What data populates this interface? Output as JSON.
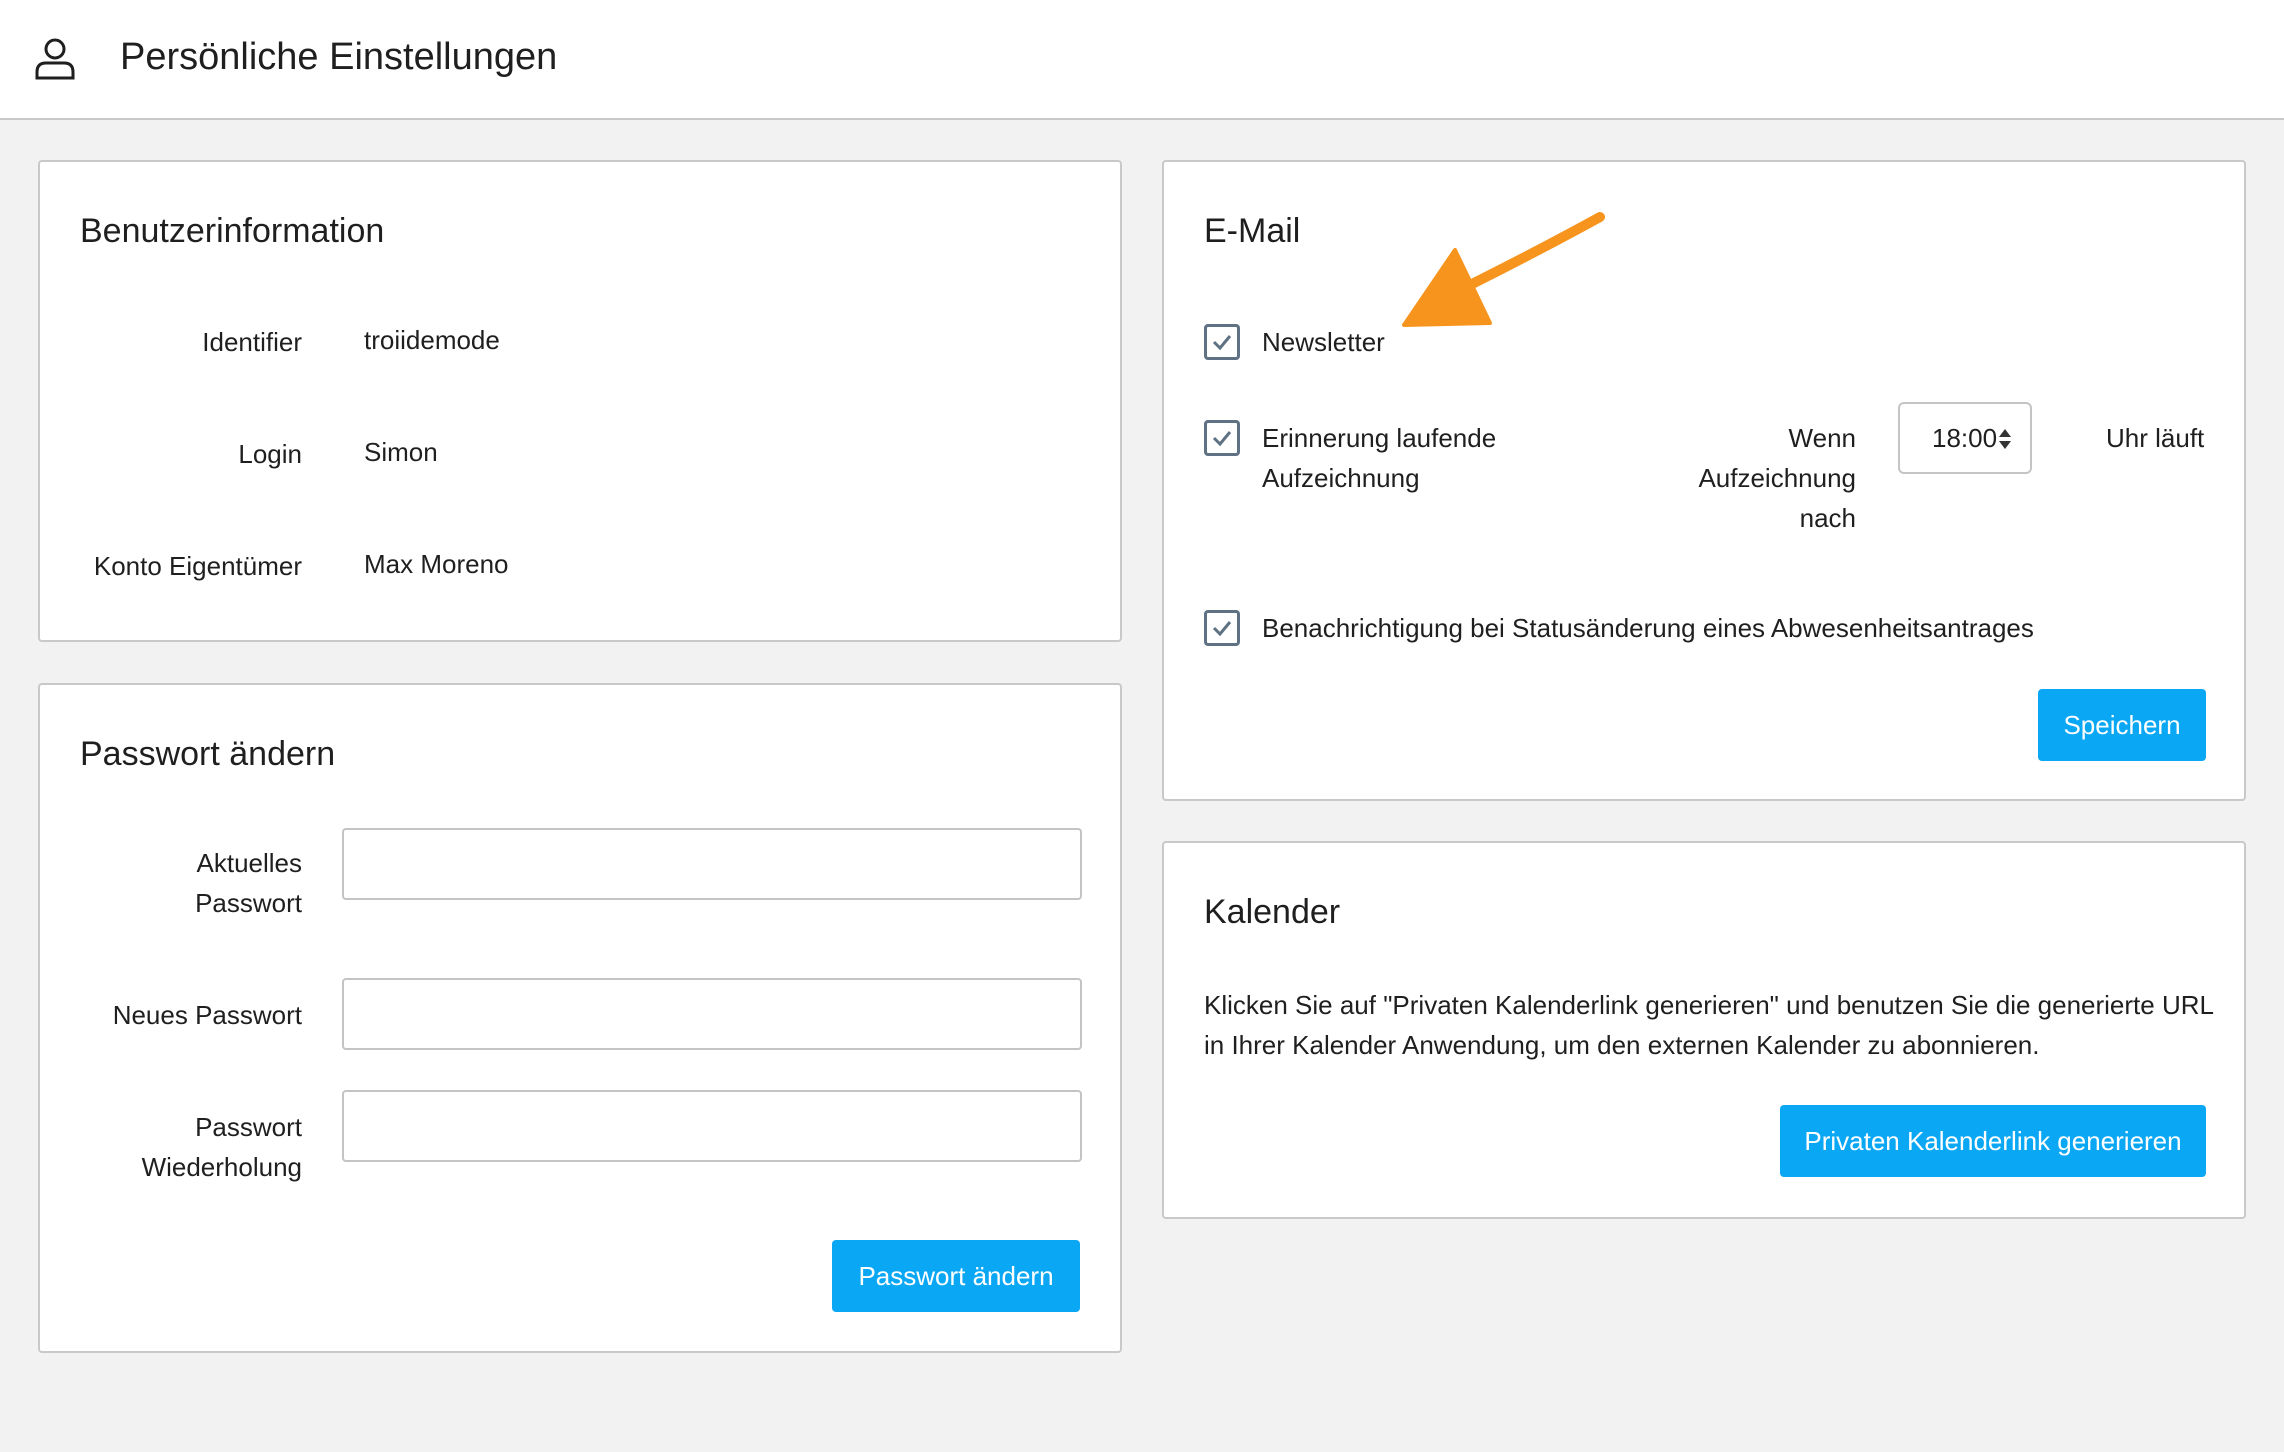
{
  "header": {
    "title": "Persönliche Einstellungen",
    "icon": "user-icon"
  },
  "user_info": {
    "title": "Benutzerinformation",
    "rows": [
      {
        "label": "Identifier",
        "value": "troiidemode"
      },
      {
        "label": "Login",
        "value": "Simon"
      },
      {
        "label": "Konto Eigentümer",
        "value": "Max Moreno"
      }
    ]
  },
  "password": {
    "title": "Passwort ändern",
    "current_label_1": "Aktuelles",
    "current_label_2": "Passwort",
    "new_label": "Neues Passwort",
    "repeat_label_1": "Passwort",
    "repeat_label_2": "Wiederholung",
    "current_value": "",
    "new_value": "",
    "repeat_value": "",
    "button": "Passwort ändern"
  },
  "email": {
    "title": "E-Mail",
    "newsletter": {
      "label": "Newsletter",
      "checked": true
    },
    "reminder": {
      "label_1": "Erinnerung laufende",
      "label_2": "Aufzeichnung",
      "checked": true,
      "when_1": "Wenn",
      "when_2": "Aufzeichnung",
      "when_3": "nach",
      "time": "18:00",
      "suffix": "Uhr läuft"
    },
    "notification": {
      "label": "Benachrichtigung bei Statusänderung eines Abwesenheitsantrages",
      "checked": true
    },
    "button": "Speichern"
  },
  "calendar": {
    "title": "Kalender",
    "text_1": "Klicken Sie auf \"Privaten Kalenderlink generieren\" und benutzen Sie die generierte URL",
    "text_2": "in Ihrer Kalender Anwendung, um den externen Kalender zu abonnieren.",
    "button": "Privaten Kalenderlink generieren"
  },
  "colors": {
    "accent": "#0aa7f5",
    "annotation_arrow": "#f7941d",
    "checkbox_border": "#5f7284"
  }
}
